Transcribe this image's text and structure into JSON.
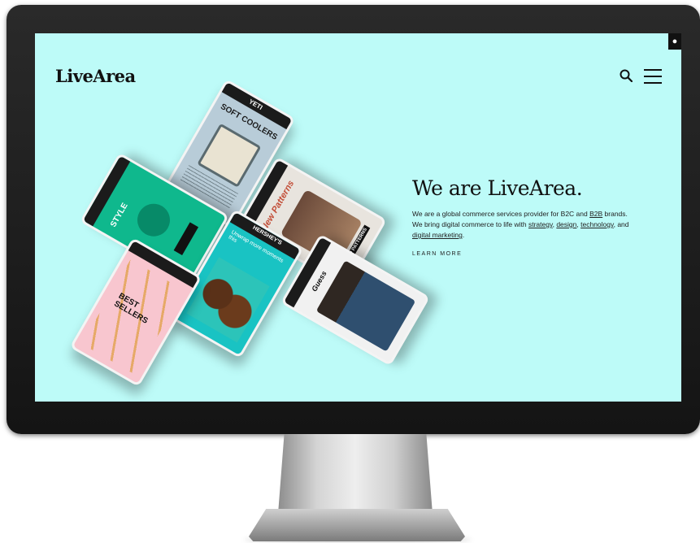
{
  "brand": {
    "logo": "LiveArea"
  },
  "header": {
    "search_icon": "search-icon",
    "menu_icon": "menu-icon",
    "globe_icon": "globe-icon"
  },
  "hero": {
    "title": "We are LiveArea.",
    "desc_part1": "We are a global commerce services provider for B2C and ",
    "link_b2b": "B2B",
    "desc_part2": " brands. We bring digital commerce to life with ",
    "link_strategy": "strategy",
    "desc_part3": ", ",
    "link_design": "design",
    "desc_part4": ", ",
    "link_technology": "technology",
    "desc_part5": ", and ",
    "link_marketing": "digital marketing",
    "desc_part6": ".",
    "cta": "LEARN MORE"
  },
  "phones": {
    "yeti_brand": "YETI",
    "yeti_headline": "SOFT COOLERS",
    "green_headline": "STYLE",
    "fashion_headline": "New Patterns",
    "fashion_cta": "SHOP PATTERNS",
    "hershey_brand": "HERSHEY'S",
    "hershey_headline": "Unwrap more moments this",
    "bestsellers_headline": "BEST SELLERS",
    "denim_brand": "Guess"
  },
  "colors": {
    "screen_bg": "#bdfbf8",
    "text": "#111111"
  }
}
